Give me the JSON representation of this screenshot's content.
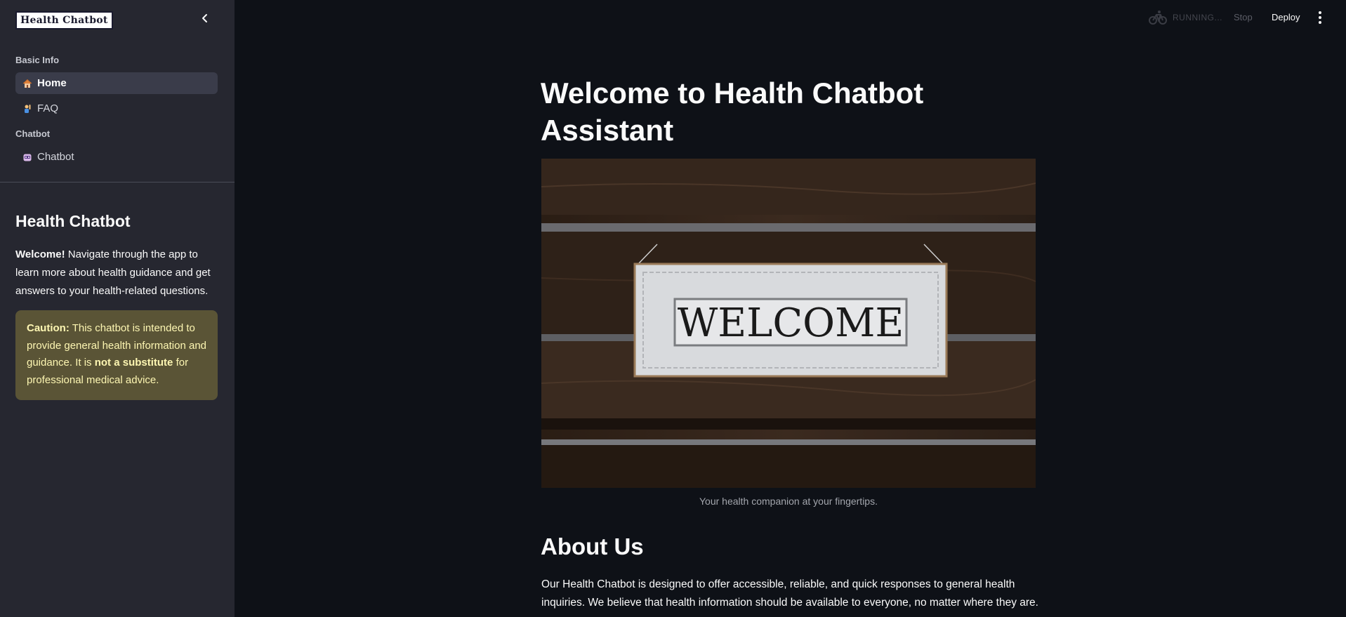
{
  "sidebar": {
    "logo_text": "Health Chatbot",
    "sections": [
      {
        "label": "Basic Info"
      },
      {
        "label": "Chatbot"
      }
    ],
    "items": [
      {
        "label": "Home",
        "icon": "house-icon",
        "active": true
      },
      {
        "label": "FAQ",
        "icon": "person-raising-hand-icon",
        "active": false
      },
      {
        "label": "Chatbot",
        "icon": "robot-icon",
        "active": false
      }
    ],
    "heading": "Health Chatbot",
    "intro_bold": "Welcome!",
    "intro_text": " Navigate through the app to learn more about health guidance and get answers to your health-related questions.",
    "caution": {
      "label": "Caution:",
      "text1": " This chatbot is intended to provide general health information and guidance. It is ",
      "bold": "not a substitute",
      "text2": " for professional medical advice."
    }
  },
  "header": {
    "status": "RUNNING...",
    "stop_label": "Stop",
    "deploy_label": "Deploy"
  },
  "main": {
    "title": "Welcome to Health Chatbot Assistant",
    "image_sign_text": "WELCOME",
    "image_caption": "Your health companion at your fingertips.",
    "about_title": "About Us",
    "about_text": "Our Health Chatbot is designed to offer accessible, reliable, and quick responses to general health inquiries. We believe that health information should be available to everyone, no matter where they are."
  },
  "colors": {
    "background": "#0e1117",
    "sidebar": "#262730",
    "caution_bg": "#5a5436",
    "caution_text": "#fdf6b2"
  }
}
